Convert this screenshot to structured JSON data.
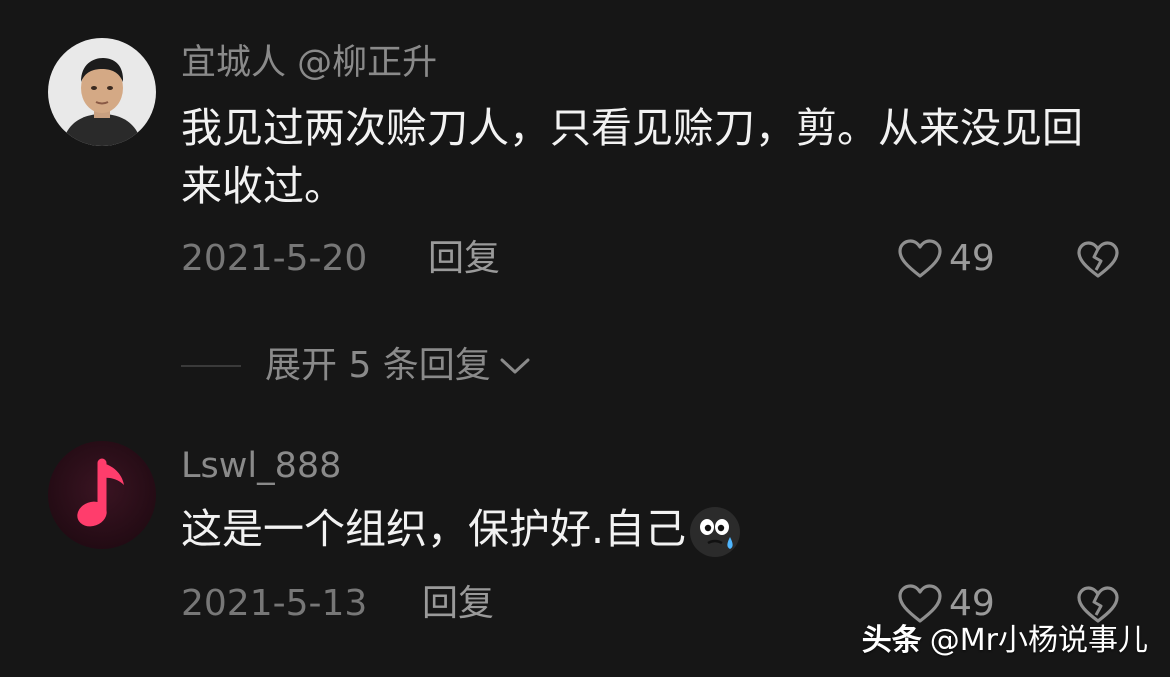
{
  "comments": [
    {
      "username": "宜城人 @柳正升",
      "text": "我见过两次赊刀人，只看见赊刀，剪。从来没见回来收过。",
      "date": "2021-5-20",
      "reply_label": "回复",
      "likes": "49",
      "avatar_icon": "person-photo-avatar"
    },
    {
      "username": "Lswl_888",
      "text": "这是一个组织，保护好.自己",
      "date": "2021-5-13",
      "reply_label": "回复",
      "likes": "49",
      "avatar_icon": "music-note-avatar",
      "emoji": "crying-face-emoji"
    }
  ],
  "expand_replies": "展开 5 条回复",
  "watermark": {
    "brand": "头条",
    "handle": "@Mr小杨说事儿"
  },
  "colors": {
    "background": "#161616",
    "primary_text": "#f2f2f2",
    "secondary_text": "#8a8a8a",
    "music_accent": "#ff3d6c"
  }
}
